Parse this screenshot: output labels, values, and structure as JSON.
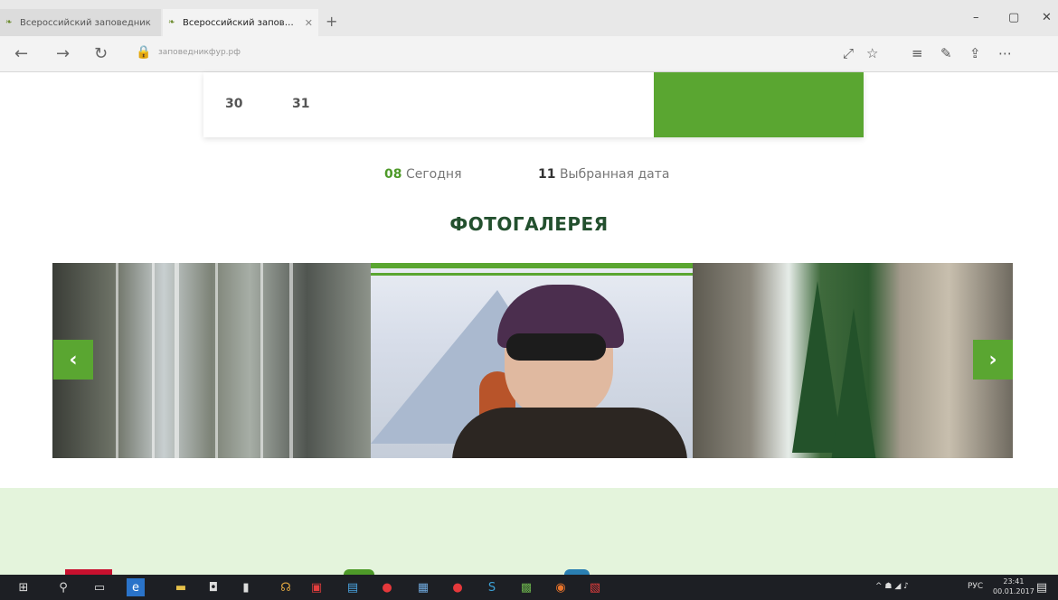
{
  "browser": {
    "tabs": [
      {
        "label": "Всероссийский заповедник",
        "active": false
      },
      {
        "label": "Всероссийский заповедник",
        "active": true
      }
    ],
    "new_tab_symbol": "+",
    "window_controls": {
      "minimize": "–",
      "maximize": "▢",
      "close": "✕"
    },
    "url": "заповедникфур.рф",
    "nav_icons": [
      "back-icon",
      "forward-icon",
      "refresh-icon"
    ],
    "toolbar_icons": [
      "reading-view-icon",
      "favorites-star-icon",
      "hub-icon",
      "web-note-icon",
      "share-icon",
      "more-icon"
    ]
  },
  "calendar": {
    "days": [
      "30",
      "31"
    ]
  },
  "legend": {
    "today_num": "08",
    "today_label": "Сегодня",
    "selected_num": "11",
    "selected_label": "Выбранная дата"
  },
  "gallery": {
    "title": "ФОТОГАЛЕРЕЯ",
    "prev_symbol": "‹",
    "next_symbol": "›"
  },
  "taskbar": {
    "lang": "РУС",
    "time": "23:41",
    "date": "00.01.2017"
  },
  "colors": {
    "accent_green": "#5aa631",
    "title_green": "#23502e",
    "footer_band": "#e4f4dc"
  }
}
